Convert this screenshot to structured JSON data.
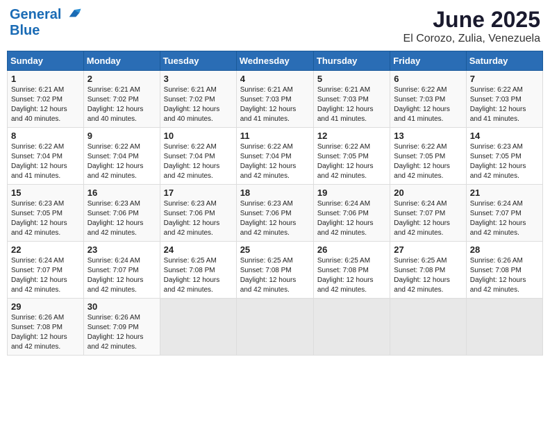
{
  "header": {
    "logo_line1": "General",
    "logo_line2": "Blue",
    "title": "June 2025",
    "subtitle": "El Corozo, Zulia, Venezuela"
  },
  "weekdays": [
    "Sunday",
    "Monday",
    "Tuesday",
    "Wednesday",
    "Thursday",
    "Friday",
    "Saturday"
  ],
  "weeks": [
    [
      {
        "day": "1",
        "info": "Sunrise: 6:21 AM\nSunset: 7:02 PM\nDaylight: 12 hours\nand 40 minutes."
      },
      {
        "day": "2",
        "info": "Sunrise: 6:21 AM\nSunset: 7:02 PM\nDaylight: 12 hours\nand 40 minutes."
      },
      {
        "day": "3",
        "info": "Sunrise: 6:21 AM\nSunset: 7:02 PM\nDaylight: 12 hours\nand 40 minutes."
      },
      {
        "day": "4",
        "info": "Sunrise: 6:21 AM\nSunset: 7:03 PM\nDaylight: 12 hours\nand 41 minutes."
      },
      {
        "day": "5",
        "info": "Sunrise: 6:21 AM\nSunset: 7:03 PM\nDaylight: 12 hours\nand 41 minutes."
      },
      {
        "day": "6",
        "info": "Sunrise: 6:22 AM\nSunset: 7:03 PM\nDaylight: 12 hours\nand 41 minutes."
      },
      {
        "day": "7",
        "info": "Sunrise: 6:22 AM\nSunset: 7:03 PM\nDaylight: 12 hours\nand 41 minutes."
      }
    ],
    [
      {
        "day": "8",
        "info": "Sunrise: 6:22 AM\nSunset: 7:04 PM\nDaylight: 12 hours\nand 41 minutes."
      },
      {
        "day": "9",
        "info": "Sunrise: 6:22 AM\nSunset: 7:04 PM\nDaylight: 12 hours\nand 42 minutes."
      },
      {
        "day": "10",
        "info": "Sunrise: 6:22 AM\nSunset: 7:04 PM\nDaylight: 12 hours\nand 42 minutes."
      },
      {
        "day": "11",
        "info": "Sunrise: 6:22 AM\nSunset: 7:04 PM\nDaylight: 12 hours\nand 42 minutes."
      },
      {
        "day": "12",
        "info": "Sunrise: 6:22 AM\nSunset: 7:05 PM\nDaylight: 12 hours\nand 42 minutes."
      },
      {
        "day": "13",
        "info": "Sunrise: 6:22 AM\nSunset: 7:05 PM\nDaylight: 12 hours\nand 42 minutes."
      },
      {
        "day": "14",
        "info": "Sunrise: 6:23 AM\nSunset: 7:05 PM\nDaylight: 12 hours\nand 42 minutes."
      }
    ],
    [
      {
        "day": "15",
        "info": "Sunrise: 6:23 AM\nSunset: 7:05 PM\nDaylight: 12 hours\nand 42 minutes."
      },
      {
        "day": "16",
        "info": "Sunrise: 6:23 AM\nSunset: 7:06 PM\nDaylight: 12 hours\nand 42 minutes."
      },
      {
        "day": "17",
        "info": "Sunrise: 6:23 AM\nSunset: 7:06 PM\nDaylight: 12 hours\nand 42 minutes."
      },
      {
        "day": "18",
        "info": "Sunrise: 6:23 AM\nSunset: 7:06 PM\nDaylight: 12 hours\nand 42 minutes."
      },
      {
        "day": "19",
        "info": "Sunrise: 6:24 AM\nSunset: 7:06 PM\nDaylight: 12 hours\nand 42 minutes."
      },
      {
        "day": "20",
        "info": "Sunrise: 6:24 AM\nSunset: 7:07 PM\nDaylight: 12 hours\nand 42 minutes."
      },
      {
        "day": "21",
        "info": "Sunrise: 6:24 AM\nSunset: 7:07 PM\nDaylight: 12 hours\nand 42 minutes."
      }
    ],
    [
      {
        "day": "22",
        "info": "Sunrise: 6:24 AM\nSunset: 7:07 PM\nDaylight: 12 hours\nand 42 minutes."
      },
      {
        "day": "23",
        "info": "Sunrise: 6:24 AM\nSunset: 7:07 PM\nDaylight: 12 hours\nand 42 minutes."
      },
      {
        "day": "24",
        "info": "Sunrise: 6:25 AM\nSunset: 7:08 PM\nDaylight: 12 hours\nand 42 minutes."
      },
      {
        "day": "25",
        "info": "Sunrise: 6:25 AM\nSunset: 7:08 PM\nDaylight: 12 hours\nand 42 minutes."
      },
      {
        "day": "26",
        "info": "Sunrise: 6:25 AM\nSunset: 7:08 PM\nDaylight: 12 hours\nand 42 minutes."
      },
      {
        "day": "27",
        "info": "Sunrise: 6:25 AM\nSunset: 7:08 PM\nDaylight: 12 hours\nand 42 minutes."
      },
      {
        "day": "28",
        "info": "Sunrise: 6:26 AM\nSunset: 7:08 PM\nDaylight: 12 hours\nand 42 minutes."
      }
    ],
    [
      {
        "day": "29",
        "info": "Sunrise: 6:26 AM\nSunset: 7:08 PM\nDaylight: 12 hours\nand 42 minutes."
      },
      {
        "day": "30",
        "info": "Sunrise: 6:26 AM\nSunset: 7:09 PM\nDaylight: 12 hours\nand 42 minutes."
      },
      {
        "day": "",
        "info": ""
      },
      {
        "day": "",
        "info": ""
      },
      {
        "day": "",
        "info": ""
      },
      {
        "day": "",
        "info": ""
      },
      {
        "day": "",
        "info": ""
      }
    ]
  ]
}
